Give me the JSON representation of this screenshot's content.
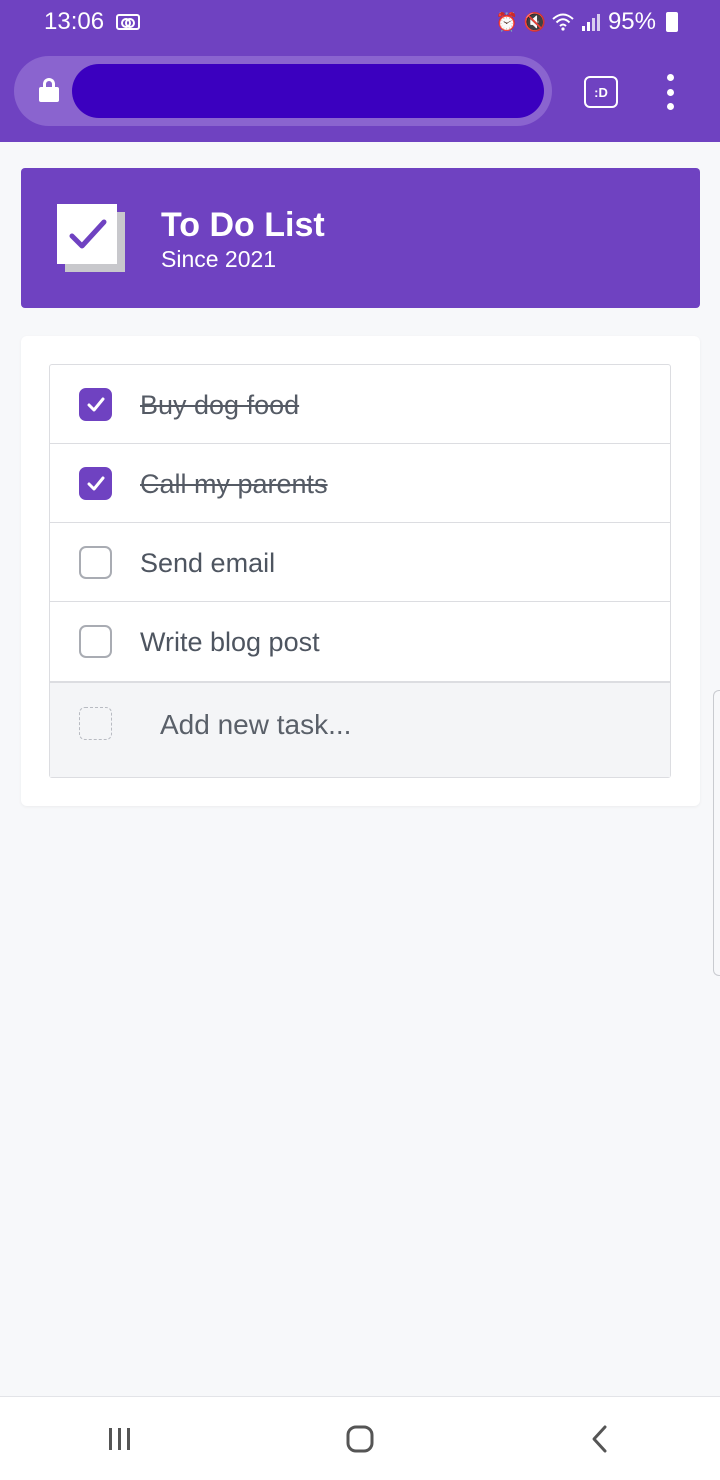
{
  "status_bar": {
    "time": "13:06",
    "battery": "95%",
    "icons": [
      "voicemail-icon",
      "alarm-icon",
      "mute-icon",
      "wifi-icon",
      "signal-icon",
      "battery-icon"
    ]
  },
  "browser": {
    "url_redacted": true,
    "tab_switcher_label": ":D",
    "icons": [
      "lock-icon",
      "menu-dots-icon"
    ]
  },
  "app": {
    "title": "To Do List",
    "subtitle": "Since 2021",
    "accent_color": "#6f42c1"
  },
  "tasks": [
    {
      "label": "Buy dog food",
      "done": true
    },
    {
      "label": "Call my parents",
      "done": true
    },
    {
      "label": "Send email",
      "done": false
    },
    {
      "label": "Write blog post",
      "done": false
    }
  ],
  "new_task": {
    "placeholder": "Add new task..."
  },
  "nav": {
    "icons": [
      "recents-icon",
      "home-icon",
      "back-icon"
    ]
  }
}
